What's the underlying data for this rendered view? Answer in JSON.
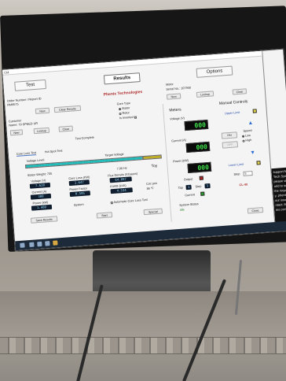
{
  "window": {
    "title": "Ct4"
  },
  "tabs": {
    "test": "Test",
    "results": "Results",
    "options": "Options"
  },
  "order": {
    "label": "Order Number / Report ID",
    "value": "RM8575",
    "new": "New",
    "clear_results": "Clear Results"
  },
  "customer": {
    "label": "Customer",
    "value": "Name: 79 SPEED UR",
    "new": "New",
    "lookup": "Lookup",
    "clear": "Clear"
  },
  "brand": "Phenix Technologies",
  "core_type": {
    "label": "Core Type",
    "options": [
      "Stator",
      "Rotor"
    ],
    "selected": "Stator",
    "inverted_label": "Is Inverted"
  },
  "motor": {
    "label": "Motor",
    "serial": "Serial No.: 107468",
    "new": "New",
    "lookup": "Lookup",
    "clear": "Clear"
  },
  "status": "Test Complete",
  "subtabs": [
    "Core Loss Test",
    "Hot Spot Test"
  ],
  "voltage_level": "Voltage Level",
  "target_voltage": "Target Voltage",
  "stator_weight": {
    "label": "Stator Weight",
    "value": "735"
  },
  "freq": "7.96 Hz",
  "toy": "Toy",
  "readings": [
    {
      "label": "Voltage (V)",
      "value": "7.620"
    },
    {
      "label": "Core Loss (KW)",
      "value": "1.647"
    },
    {
      "label": "Flux Density (KGauss)",
      "value": "64.097"
    },
    {
      "label": "Current (A)",
      "value": "300"
    },
    {
      "label": "Power Factor",
      "value": "0.595"
    },
    {
      "label": "KVAR (kVA)",
      "value": "4.534"
    },
    {
      "label": "Power (kW)",
      "value": "1.480"
    }
  ],
  "circ_temp": {
    "label": "Circ pos",
    "value": "86 °F"
  },
  "system_label": "System",
  "auto_core_loss": "Automatic Core Loss Test",
  "actions": {
    "save_results": "Save Results",
    "start": "Start",
    "special": "Special",
    "close": "Close"
  },
  "meters": {
    "title": "Meters",
    "voltage_label": "Voltage (V)",
    "voltage": "000",
    "current_label": "Current (A)",
    "current": "000",
    "power_label": "Power (kW)",
    "power": "000",
    "output_label": "Output",
    "tap_label": "Tap",
    "tap_value": "1",
    "step_label": "Step",
    "step_value": "1",
    "current_indicator_label": "Current",
    "system_status_label": "System Status",
    "system_status_value": "Idle"
  },
  "manual": {
    "title": "Manual Controls",
    "upper_limit": "Upper Limit",
    "on": "ON",
    "off": "OFF",
    "speed_label": "Speed",
    "speed_options": [
      "Low",
      "High"
    ],
    "speed_selected": "Low",
    "lower_limit": "Lower Limit",
    "step_label": "Step",
    "step_value": "5",
    "code": "CL-40"
  },
  "side_text": [
    "support for you",
    "Tech System",
    "please visit",
    "orld to submit a",
    "the request for",
    "y, phone num",
    "our issue.",
    "ntact: 864-2880",
    "ies.com"
  ],
  "colors": {
    "lcd_green": "#3ee04a",
    "output_red": "#b02020",
    "current_green": "#2a9a2a",
    "limit_yellow": "#e7d84a"
  }
}
